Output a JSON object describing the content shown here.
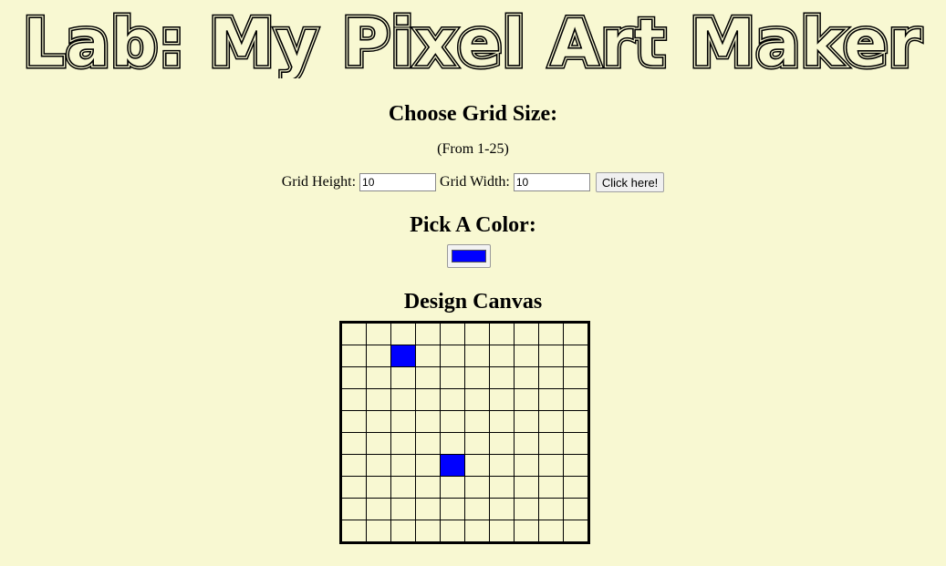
{
  "title": "Lab: My Pixel Art Maker",
  "grid_section": {
    "heading": "Choose Grid Size:",
    "range_note": "(From 1-25)",
    "height_label": "Grid Height:",
    "height_value": "10",
    "width_label": "Grid Width:",
    "width_value": "10",
    "submit_label": "Click here!"
  },
  "color_section": {
    "heading": "Pick A Color:",
    "selected_color": "#0000ff"
  },
  "canvas_section": {
    "heading": "Design Canvas",
    "rows": 10,
    "cols": 10,
    "painted_cells": [
      {
        "row": 1,
        "col": 2,
        "color": "#0000ff"
      },
      {
        "row": 6,
        "col": 4,
        "color": "#0000ff"
      }
    ]
  },
  "colors": {
    "background": "#f8f8d2",
    "grid_line": "#000000"
  }
}
